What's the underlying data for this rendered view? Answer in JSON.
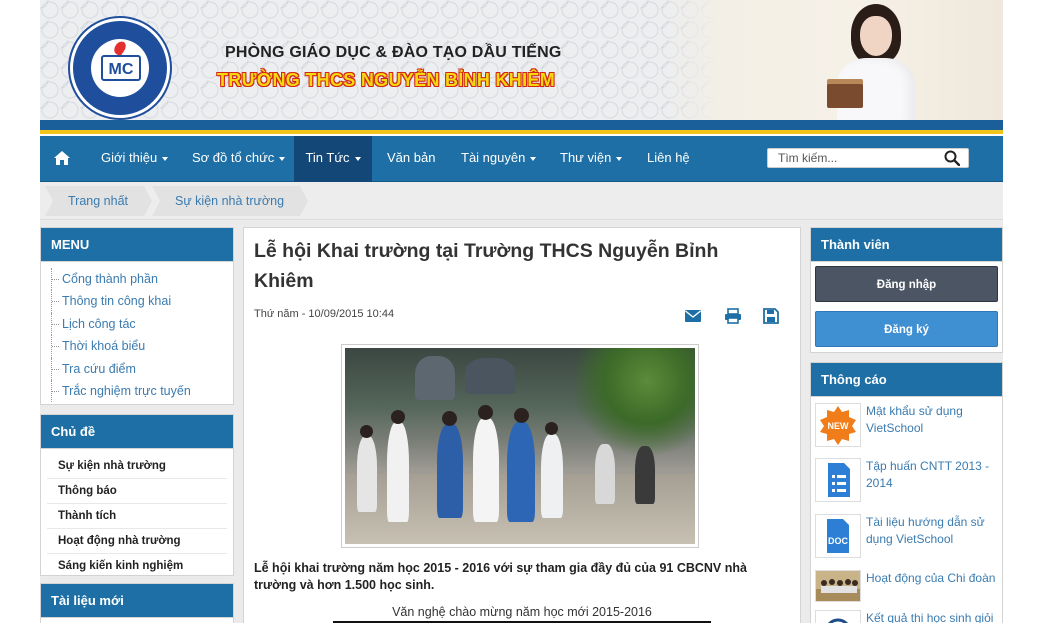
{
  "header": {
    "line1": "PHÒNG GIÁO DỤC & ĐÀO TẠO DẦU TIẾNG",
    "line2": "TRƯỜNG THCS NGUYỄN BỈNH KHIÊM",
    "logo_mark": "MC"
  },
  "nav": {
    "items": [
      {
        "label": "Giới thiệu",
        "dropdown": true
      },
      {
        "label": "Sơ đồ tổ chức",
        "dropdown": true
      },
      {
        "label": "Tin Tức",
        "dropdown": true,
        "active": true
      },
      {
        "label": "Văn bản",
        "dropdown": false
      },
      {
        "label": "Tài nguyên",
        "dropdown": true
      },
      {
        "label": "Thư viện",
        "dropdown": true
      },
      {
        "label": "Liên hệ",
        "dropdown": false
      }
    ],
    "search_placeholder": "Tìm kiếm..."
  },
  "breadcrumb": [
    "Trang nhất",
    "Sự kiện nhà trường"
  ],
  "left": {
    "menu_title": "MENU",
    "menu_items": [
      "Cổng thành phần",
      "Thông tin công khai",
      "Lịch công tác",
      "Thời khoá biểu",
      "Tra cứu điểm",
      "Trắc nghiệm trực tuyến"
    ],
    "topics_title": "Chủ đề",
    "topics": [
      "Sự kiện nhà trường",
      "Thông báo",
      "Thành tích",
      "Hoạt động nhà trường",
      "Sáng kiến kinh nghiệm"
    ],
    "docs_title": "Tài liệu mới"
  },
  "article": {
    "title": "Lễ hội Khai trường tại Trường THCS Nguyễn Bỉnh Khiêm",
    "date": "Thứ năm - 10/09/2015 10:44",
    "lead": "Lễ hội khai trường năm học 2015 - 2016 với sự tham gia đầy đủ của 91 CBCNV nhà trường và hơn 1.500 học sinh.",
    "caption": "Văn nghệ chào mừng năm học mới 2015-2016"
  },
  "right": {
    "members_title": "Thành viên",
    "login_label": "Đăng nhập",
    "register_label": "Đăng ký",
    "notices_title": "Thông cáo",
    "new_badge": "NEW",
    "doc_badge": "DOC",
    "notices": [
      "Mật khẩu sử dụng VietSchool",
      "Tập huấn CNTT 2013 - 2014",
      "Tài liệu hướng dẫn sử dụng VietSchool",
      "Hoạt động của Chi đoàn",
      "Kết quả thi học sinh giỏi"
    ]
  },
  "colors": {
    "nav": "#1d6fa5",
    "nav_active": "#124777",
    "link": "#3a7bb0",
    "yellow_stripe": "#f0c41b"
  }
}
